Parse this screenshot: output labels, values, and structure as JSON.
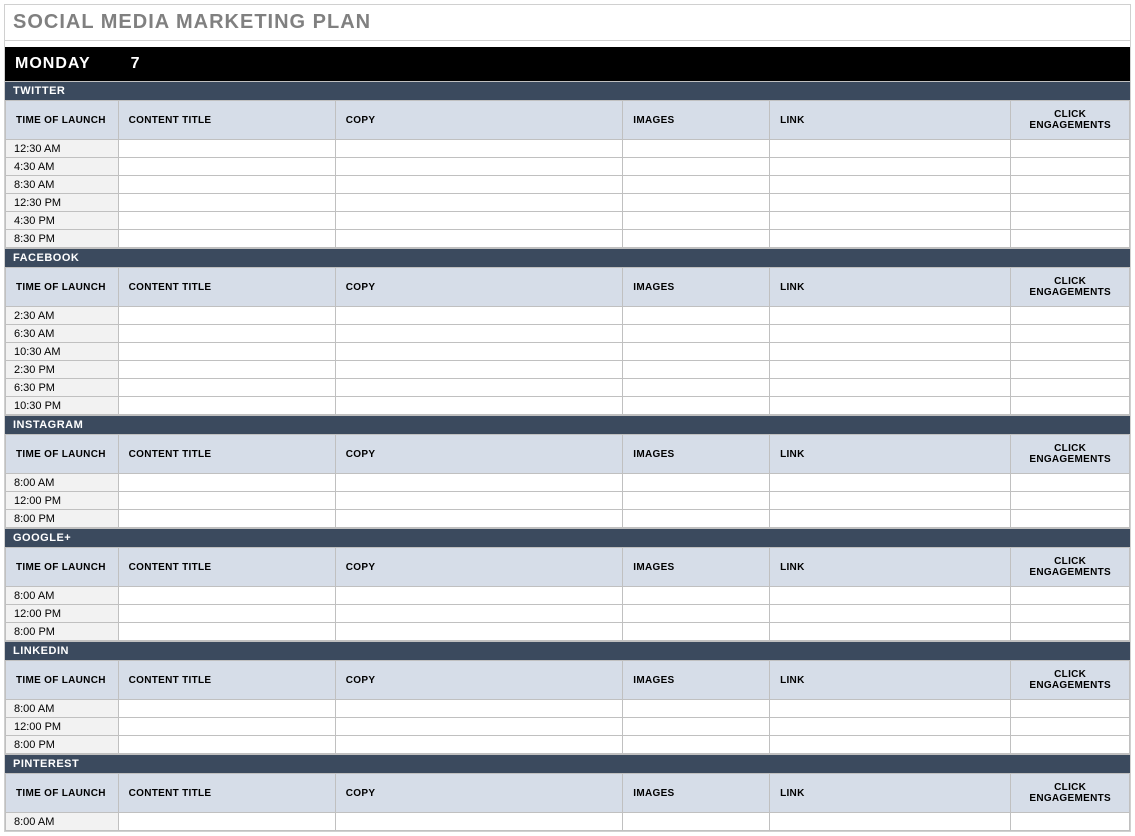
{
  "title": "SOCIAL MEDIA MARKETING PLAN",
  "day": {
    "name": "MONDAY",
    "date": "7"
  },
  "columns": {
    "time": "TIME OF LAUNCH",
    "content_title": "CONTENT TITLE",
    "copy": "COPY",
    "images": "IMAGES",
    "link": "LINK",
    "clicks": "CLICK ENGAGEMENTS"
  },
  "sections": [
    {
      "name": "TWITTER",
      "rows": [
        {
          "time": "12:30 AM",
          "content_title": "",
          "copy": "",
          "images": "",
          "link": "",
          "clicks": ""
        },
        {
          "time": "4:30 AM",
          "content_title": "",
          "copy": "",
          "images": "",
          "link": "",
          "clicks": ""
        },
        {
          "time": "8:30 AM",
          "content_title": "",
          "copy": "",
          "images": "",
          "link": "",
          "clicks": ""
        },
        {
          "time": "12:30 PM",
          "content_title": "",
          "copy": "",
          "images": "",
          "link": "",
          "clicks": ""
        },
        {
          "time": "4:30 PM",
          "content_title": "",
          "copy": "",
          "images": "",
          "link": "",
          "clicks": ""
        },
        {
          "time": "8:30 PM",
          "content_title": "",
          "copy": "",
          "images": "",
          "link": "",
          "clicks": ""
        }
      ]
    },
    {
      "name": "FACEBOOK",
      "rows": [
        {
          "time": "2:30 AM",
          "content_title": "",
          "copy": "",
          "images": "",
          "link": "",
          "clicks": ""
        },
        {
          "time": "6:30 AM",
          "content_title": "",
          "copy": "",
          "images": "",
          "link": "",
          "clicks": ""
        },
        {
          "time": "10:30 AM",
          "content_title": "",
          "copy": "",
          "images": "",
          "link": "",
          "clicks": ""
        },
        {
          "time": "2:30 PM",
          "content_title": "",
          "copy": "",
          "images": "",
          "link": "",
          "clicks": ""
        },
        {
          "time": "6:30 PM",
          "content_title": "",
          "copy": "",
          "images": "",
          "link": "",
          "clicks": ""
        },
        {
          "time": "10:30 PM",
          "content_title": "",
          "copy": "",
          "images": "",
          "link": "",
          "clicks": ""
        }
      ]
    },
    {
      "name": "INSTAGRAM",
      "rows": [
        {
          "time": "8:00 AM",
          "content_title": "",
          "copy": "",
          "images": "",
          "link": "",
          "clicks": ""
        },
        {
          "time": "12:00 PM",
          "content_title": "",
          "copy": "",
          "images": "",
          "link": "",
          "clicks": ""
        },
        {
          "time": "8:00 PM",
          "content_title": "",
          "copy": "",
          "images": "",
          "link": "",
          "clicks": ""
        }
      ]
    },
    {
      "name": "GOOGLE+",
      "rows": [
        {
          "time": "8:00 AM",
          "content_title": "",
          "copy": "",
          "images": "",
          "link": "",
          "clicks": ""
        },
        {
          "time": "12:00 PM",
          "content_title": "",
          "copy": "",
          "images": "",
          "link": "",
          "clicks": ""
        },
        {
          "time": "8:00 PM",
          "content_title": "",
          "copy": "",
          "images": "",
          "link": "",
          "clicks": ""
        }
      ]
    },
    {
      "name": "LINKEDIN",
      "rows": [
        {
          "time": "8:00 AM",
          "content_title": "",
          "copy": "",
          "images": "",
          "link": "",
          "clicks": ""
        },
        {
          "time": "12:00 PM",
          "content_title": "",
          "copy": "",
          "images": "",
          "link": "",
          "clicks": ""
        },
        {
          "time": "8:00 PM",
          "content_title": "",
          "copy": "",
          "images": "",
          "link": "",
          "clicks": ""
        }
      ]
    },
    {
      "name": "PINTEREST",
      "rows": [
        {
          "time": "8:00 AM",
          "content_title": "",
          "copy": "",
          "images": "",
          "link": "",
          "clicks": ""
        }
      ]
    }
  ]
}
